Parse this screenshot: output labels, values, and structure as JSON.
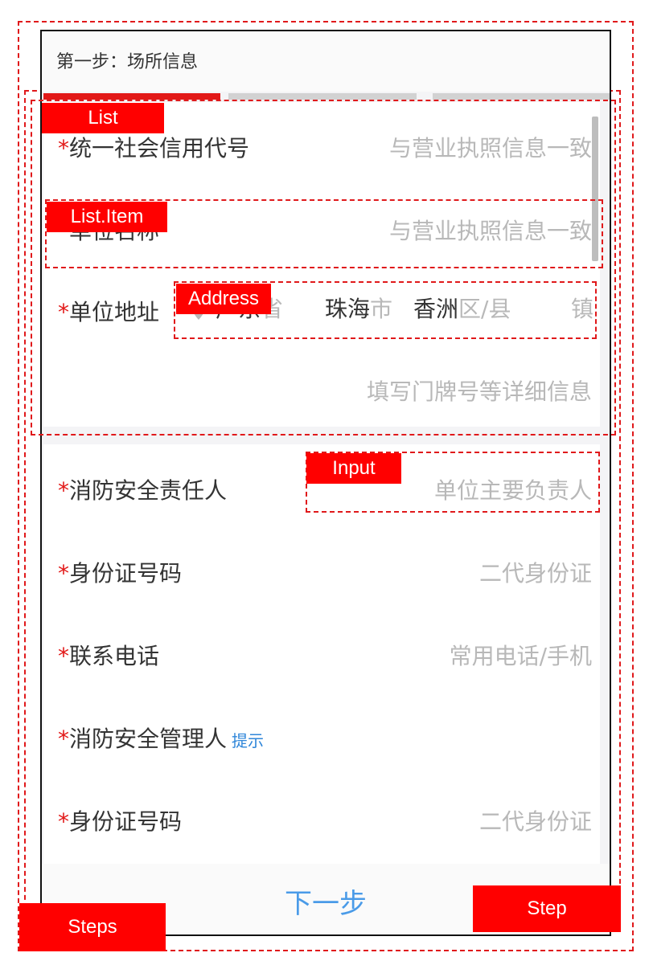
{
  "header": {
    "title": "第一步：场所信息"
  },
  "progress": {
    "colors": {
      "active": "#e21918",
      "inactive": "#d2d2d2"
    }
  },
  "section1": {
    "rows": [
      {
        "required": "*",
        "label": "统一社会信用代号",
        "placeholder": "与营业执照信息一致"
      },
      {
        "required": "*",
        "label": "单位名称",
        "placeholder": "与营业执照信息一致"
      }
    ],
    "address": {
      "required": "*",
      "label": "单位地址",
      "location_icon": "location-pin-icon",
      "province_value": "广东",
      "province_unit": "省",
      "city_value": "珠海",
      "city_unit": "市",
      "district_value": "香洲",
      "district_unit": "区/县",
      "town_unit": "镇",
      "detail_placeholder": "填写门牌号等详细信息"
    }
  },
  "section2": {
    "rows": [
      {
        "required": "*",
        "label": "消防安全责任人",
        "placeholder": "单位主要负责人"
      },
      {
        "required": "*",
        "label": "身份证号码",
        "placeholder": "二代身份证"
      },
      {
        "required": "*",
        "label": "联系电话",
        "placeholder": "常用电话/手机"
      },
      {
        "required": "*",
        "label": "消防安全管理人",
        "hint": "提示"
      },
      {
        "required": "*",
        "label": "身份证号码",
        "placeholder": "二代身份证"
      }
    ]
  },
  "footer": {
    "next_label": "下一步"
  },
  "annotations": {
    "list": "List",
    "list_item": "List.Item",
    "address": "Address",
    "input": "Input",
    "steps": "Steps",
    "step": "Step"
  }
}
